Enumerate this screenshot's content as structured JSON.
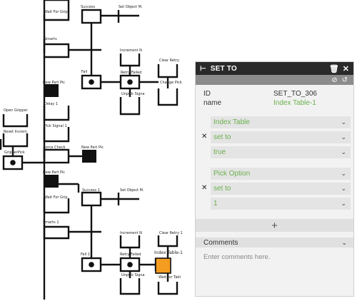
{
  "tree": {
    "labels": {
      "wait_for_grip": "Wait For Grip",
      "success": "Success",
      "set_object": "Set Object M.",
      "smarts": "Smarts",
      "increment": "Increment N",
      "clear_retry": "Clear Retry",
      "retry_failed": "Retry Failed",
      "change_pick": "Change Pick",
      "fail": "Fail",
      "unpick_signal": "Unpick Signa",
      "new_part_pic": "New Part Pic",
      "delay": "Delay 1",
      "open_gripper": "Open Gripper",
      "reset_incr": "Reset Increm",
      "pick_signal": "Pick Signal 1",
      "force_check": "Force Check",
      "new_part_pic_2": "New Part Pic",
      "gripper_pick": "GripperPick",
      "new_part_pic_3": "New Part Pic",
      "wait_for_grip_2": "Wait For Grip",
      "success_1": "Success 1",
      "set_object_2": "Set Object M.",
      "smarts_1": "Smarts 1",
      "increment_2": "Increment N",
      "clear_retry_1": "Clear Retry 1",
      "retry_failed_2": "Retry Failed",
      "index_table": "Index Table-1",
      "fail_1": "Fail 1",
      "unpick_signal_2": "Unpick Signa",
      "wait_for_table": "Wait for Tabl"
    }
  },
  "panel": {
    "title": "SET TO",
    "icons": {
      "header_left": "set-node-icon",
      "delete": "trash-icon",
      "close": "close-icon",
      "disable": "disable-icon",
      "refresh": "refresh-icon"
    },
    "id_label": "ID",
    "id_value": "SET_TO_306",
    "name_label": "name",
    "name_value": "Index Table-1",
    "groups": [
      {
        "target": "Index Table",
        "operator": "set to",
        "value": "true"
      },
      {
        "target": "Pick Option",
        "operator": "set to",
        "value": "1"
      }
    ],
    "add_symbol": "+",
    "comments_label": "Comments",
    "comments_placeholder": "Enter comments here.",
    "accent": "#6ab04c",
    "selected_node_color": "#f39c1f"
  }
}
